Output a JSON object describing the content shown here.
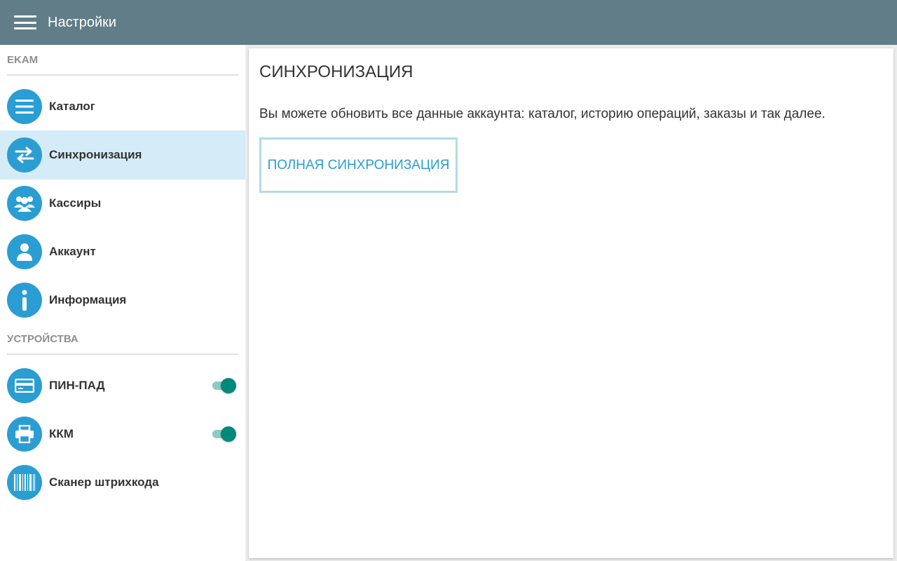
{
  "app": {
    "title": "Настройки",
    "menu_icon": "hamburger-menu-icon"
  },
  "sidebar": {
    "sections": [
      {
        "header": "EKAM",
        "items": [
          {
            "label": "Каталог",
            "icon": "list-icon",
            "active": false
          },
          {
            "label": "Синхронизация",
            "icon": "sync-arrows-icon",
            "active": true
          },
          {
            "label": "Кассиры",
            "icon": "group-icon",
            "active": false
          },
          {
            "label": "Аккаунт",
            "icon": "person-icon",
            "active": false
          },
          {
            "label": "Информация",
            "icon": "info-icon",
            "active": false
          }
        ]
      },
      {
        "header": "УСТРОЙСТВА",
        "items": [
          {
            "label": "ПИН-ПАД",
            "icon": "card-icon",
            "toggle": true
          },
          {
            "label": "ККМ",
            "icon": "printer-icon",
            "toggle": true
          },
          {
            "label": "Сканер штрихкода",
            "icon": "barcode-icon"
          }
        ]
      }
    ]
  },
  "content": {
    "title": "СИНХРОНИЗАЦИЯ",
    "description": "Вы можете обновить все данные аккаунта: каталог, историю операций, заказы и так далее.",
    "button_label": "ПОЛНАЯ СИНХРОНИЗАЦИЯ"
  },
  "colors": {
    "toolbar": "#607d88",
    "accent": "#2a9ed2",
    "active_item_bg": "#d4ecf7",
    "toggle_on": "#00897b"
  }
}
